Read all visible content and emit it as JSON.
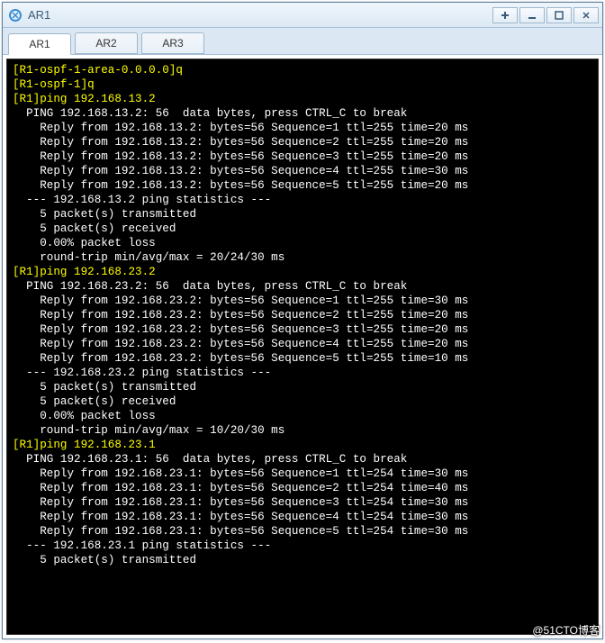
{
  "window": {
    "title": "AR1",
    "icon_name": "ensp-router-icon"
  },
  "tabs": [
    {
      "label": "AR1",
      "active": true
    },
    {
      "label": "AR2",
      "active": false
    },
    {
      "label": "AR3",
      "active": false
    }
  ],
  "watermark": "@51CTO博客",
  "terminal": {
    "lines": [
      {
        "c": "yellow",
        "t": "[R1-ospf-1-area-0.0.0.0]q"
      },
      {
        "c": "yellow",
        "t": "[R1-ospf-1]q"
      },
      {
        "c": "yellow",
        "t": "[R1]ping 192.168.13.2"
      },
      {
        "c": "white",
        "t": "  PING 192.168.13.2: 56  data bytes, press CTRL_C to break"
      },
      {
        "c": "white",
        "t": "    Reply from 192.168.13.2: bytes=56 Sequence=1 ttl=255 time=20 ms"
      },
      {
        "c": "white",
        "t": "    Reply from 192.168.13.2: bytes=56 Sequence=2 ttl=255 time=20 ms"
      },
      {
        "c": "white",
        "t": "    Reply from 192.168.13.2: bytes=56 Sequence=3 ttl=255 time=20 ms"
      },
      {
        "c": "white",
        "t": "    Reply from 192.168.13.2: bytes=56 Sequence=4 ttl=255 time=30 ms"
      },
      {
        "c": "white",
        "t": "    Reply from 192.168.13.2: bytes=56 Sequence=5 ttl=255 time=20 ms"
      },
      {
        "c": "white",
        "t": ""
      },
      {
        "c": "white",
        "t": "  --- 192.168.13.2 ping statistics ---"
      },
      {
        "c": "white",
        "t": "    5 packet(s) transmitted"
      },
      {
        "c": "white",
        "t": "    5 packet(s) received"
      },
      {
        "c": "white",
        "t": "    0.00% packet loss"
      },
      {
        "c": "white",
        "t": "    round-trip min/avg/max = 20/24/30 ms"
      },
      {
        "c": "white",
        "t": ""
      },
      {
        "c": "yellow",
        "t": "[R1]ping 192.168.23.2"
      },
      {
        "c": "white",
        "t": "  PING 192.168.23.2: 56  data bytes, press CTRL_C to break"
      },
      {
        "c": "white",
        "t": "    Reply from 192.168.23.2: bytes=56 Sequence=1 ttl=255 time=30 ms"
      },
      {
        "c": "white",
        "t": "    Reply from 192.168.23.2: bytes=56 Sequence=2 ttl=255 time=20 ms"
      },
      {
        "c": "white",
        "t": "    Reply from 192.168.23.2: bytes=56 Sequence=3 ttl=255 time=20 ms"
      },
      {
        "c": "white",
        "t": "    Reply from 192.168.23.2: bytes=56 Sequence=4 ttl=255 time=20 ms"
      },
      {
        "c": "white",
        "t": "    Reply from 192.168.23.2: bytes=56 Sequence=5 ttl=255 time=10 ms"
      },
      {
        "c": "white",
        "t": ""
      },
      {
        "c": "white",
        "t": "  --- 192.168.23.2 ping statistics ---"
      },
      {
        "c": "white",
        "t": "    5 packet(s) transmitted"
      },
      {
        "c": "white",
        "t": "    5 packet(s) received"
      },
      {
        "c": "white",
        "t": "    0.00% packet loss"
      },
      {
        "c": "white",
        "t": "    round-trip min/avg/max = 10/20/30 ms"
      },
      {
        "c": "white",
        "t": ""
      },
      {
        "c": "yellow",
        "t": "[R1]ping 192.168.23.1"
      },
      {
        "c": "white",
        "t": "  PING 192.168.23.1: 56  data bytes, press CTRL_C to break"
      },
      {
        "c": "white",
        "t": "    Reply from 192.168.23.1: bytes=56 Sequence=1 ttl=254 time=30 ms"
      },
      {
        "c": "white",
        "t": "    Reply from 192.168.23.1: bytes=56 Sequence=2 ttl=254 time=40 ms"
      },
      {
        "c": "white",
        "t": "    Reply from 192.168.23.1: bytes=56 Sequence=3 ttl=254 time=30 ms"
      },
      {
        "c": "white",
        "t": "    Reply from 192.168.23.1: bytes=56 Sequence=4 ttl=254 time=30 ms"
      },
      {
        "c": "white",
        "t": "    Reply from 192.168.23.1: bytes=56 Sequence=5 ttl=254 time=30 ms"
      },
      {
        "c": "white",
        "t": ""
      },
      {
        "c": "white",
        "t": "  --- 192.168.23.1 ping statistics ---"
      },
      {
        "c": "white",
        "t": "    5 packet(s) transmitted"
      }
    ]
  }
}
